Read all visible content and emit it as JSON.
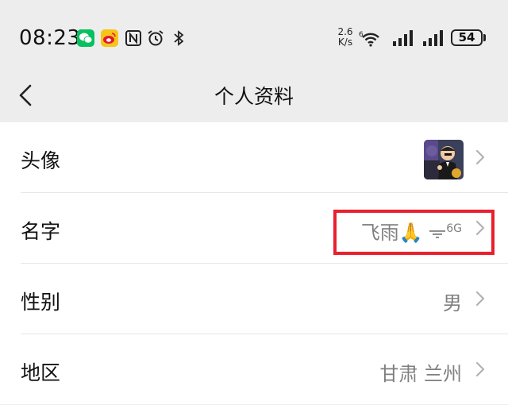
{
  "status_bar": {
    "time": "08:23",
    "speed_value": "2.6",
    "speed_unit": "K/s",
    "battery": "54",
    "icons": [
      "wechat-icon",
      "weibo-icon",
      "nfc-icon",
      "alarm-icon",
      "bluetooth-icon",
      "wifi-6-icon",
      "signal-icon",
      "signal-icon"
    ]
  },
  "header": {
    "title": "个人资料",
    "back_icon": "chevron-left-icon"
  },
  "profile": {
    "rows": [
      {
        "label": "头像",
        "value": ""
      },
      {
        "label": "名字",
        "value_text": "飞雨🙏",
        "value_suffix": "6G"
      },
      {
        "label": "性别",
        "value": "男"
      },
      {
        "label": "地区",
        "value": "甘肃 兰州"
      }
    ]
  },
  "colors": {
    "background": "#ededed",
    "highlight": "#e8202f",
    "wechat_green": "#07c160"
  }
}
